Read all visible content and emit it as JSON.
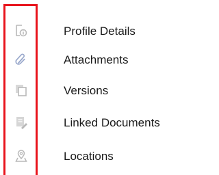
{
  "nav": {
    "items": [
      {
        "label": "Profile Details",
        "icon": "profile-info-icon"
      },
      {
        "label": "Attachments",
        "icon": "paperclip-icon"
      },
      {
        "label": "Versions",
        "icon": "versions-icon"
      },
      {
        "label": "Linked Documents",
        "icon": "linked-document-icon"
      },
      {
        "label": "Locations",
        "icon": "location-pin-icon"
      }
    ]
  },
  "colors": {
    "highlight_border": "#e8141c",
    "icon_gray": "#b9b9b9",
    "icon_blue": "#9aa9cc",
    "text": "#1a1a1a"
  }
}
